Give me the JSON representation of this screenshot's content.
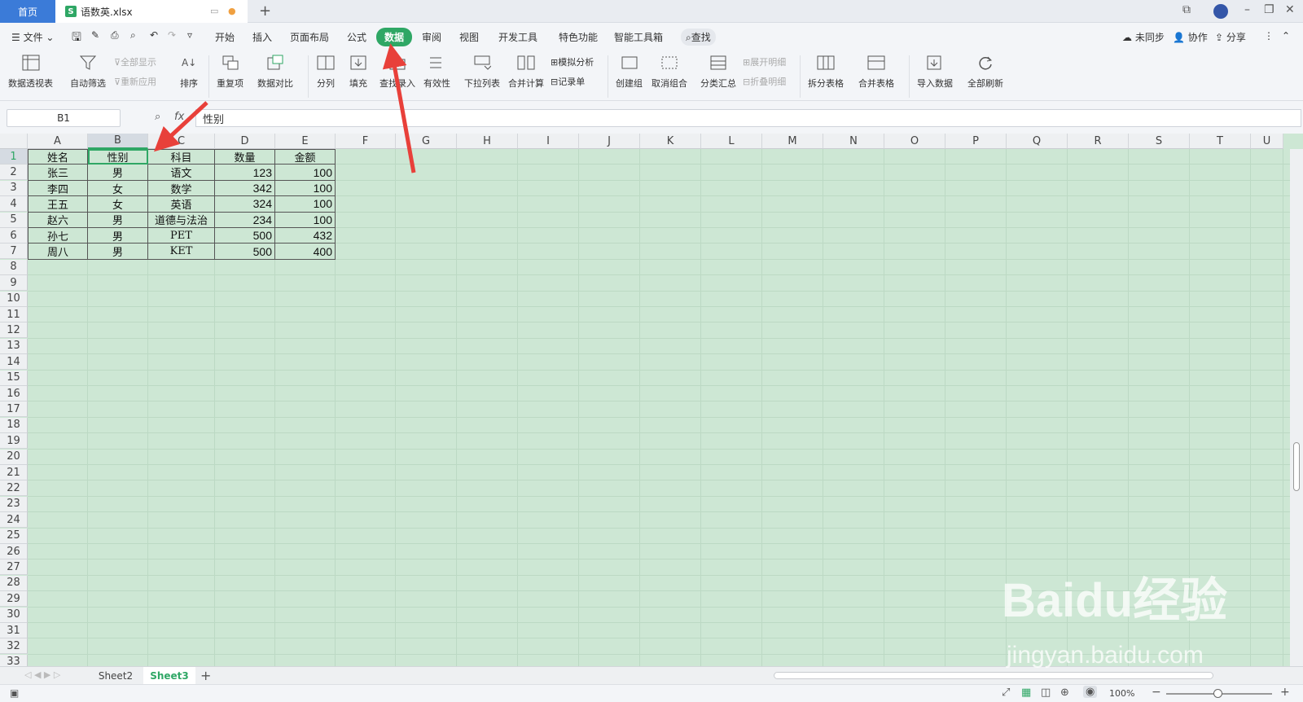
{
  "titlebar": {
    "home_tab": "首页",
    "file_tab": "语数英.xlsx",
    "file_badge": "S"
  },
  "menu": {
    "file": "文件",
    "tabs": [
      "开始",
      "插入",
      "页面布局",
      "公式",
      "数据",
      "审阅",
      "视图",
      "开发工具",
      "特色功能",
      "智能工具箱"
    ],
    "active_tab": "数据",
    "search": "查找",
    "right": [
      "未同步",
      "协作",
      "分享"
    ]
  },
  "ribbon": {
    "big": [
      "数据透视表",
      "自动筛选",
      "排序",
      "重复项",
      "数据对比",
      "分列",
      "填充",
      "查找录入",
      "有效性",
      "下拉列表",
      "合并计算",
      "创建组",
      "取消组合",
      "分类汇总",
      "拆分表格",
      "合并表格",
      "导入数据",
      "全部刷新"
    ],
    "small": [
      "全部显示",
      "重新应用",
      "模拟分析",
      "记录单",
      "展开明细",
      "折叠明细"
    ]
  },
  "formula_bar": {
    "name_box": "B1",
    "fx": "fx",
    "content": "性别"
  },
  "grid": {
    "columns": [
      "A",
      "B",
      "C",
      "D",
      "E",
      "F",
      "G",
      "H",
      "I",
      "J",
      "K",
      "L",
      "M",
      "N",
      "O",
      "P",
      "Q",
      "R",
      "S",
      "T",
      "U"
    ],
    "rows": [
      "1",
      "2",
      "3",
      "4",
      "5",
      "6",
      "7",
      "8",
      "9",
      "10",
      "11",
      "12",
      "13",
      "14",
      "15",
      "16",
      "17",
      "18",
      "19",
      "20",
      "21",
      "22",
      "23",
      "24",
      "25",
      "26",
      "27",
      "28",
      "29",
      "30",
      "31",
      "32",
      "33"
    ],
    "headers": [
      "姓名",
      "性别",
      "科目",
      "数量",
      "金额"
    ],
    "data": [
      [
        "张三",
        "男",
        "语文",
        "123",
        "100"
      ],
      [
        "李四",
        "女",
        "数学",
        "342",
        "100"
      ],
      [
        "王五",
        "女",
        "英语",
        "324",
        "100"
      ],
      [
        "赵六",
        "男",
        "道德与法治",
        "234",
        "100"
      ],
      [
        "孙七",
        "男",
        "PET",
        "500",
        "432"
      ],
      [
        "周八",
        "男",
        "KET",
        "500",
        "400"
      ]
    ],
    "selected_cell": "B1"
  },
  "sheets": {
    "tabs": [
      "Sheet2",
      "Sheet3"
    ],
    "active": "Sheet3"
  },
  "status": {
    "zoom": "100%"
  },
  "watermark": {
    "logo": "Baidu经验",
    "url": "jingyan.baidu.com"
  },
  "colors": {
    "accent": "#2fa765",
    "grid_bg": "#cde7d4",
    "home_tab": "#3b7bd8",
    "arrow": "#e8403a"
  }
}
